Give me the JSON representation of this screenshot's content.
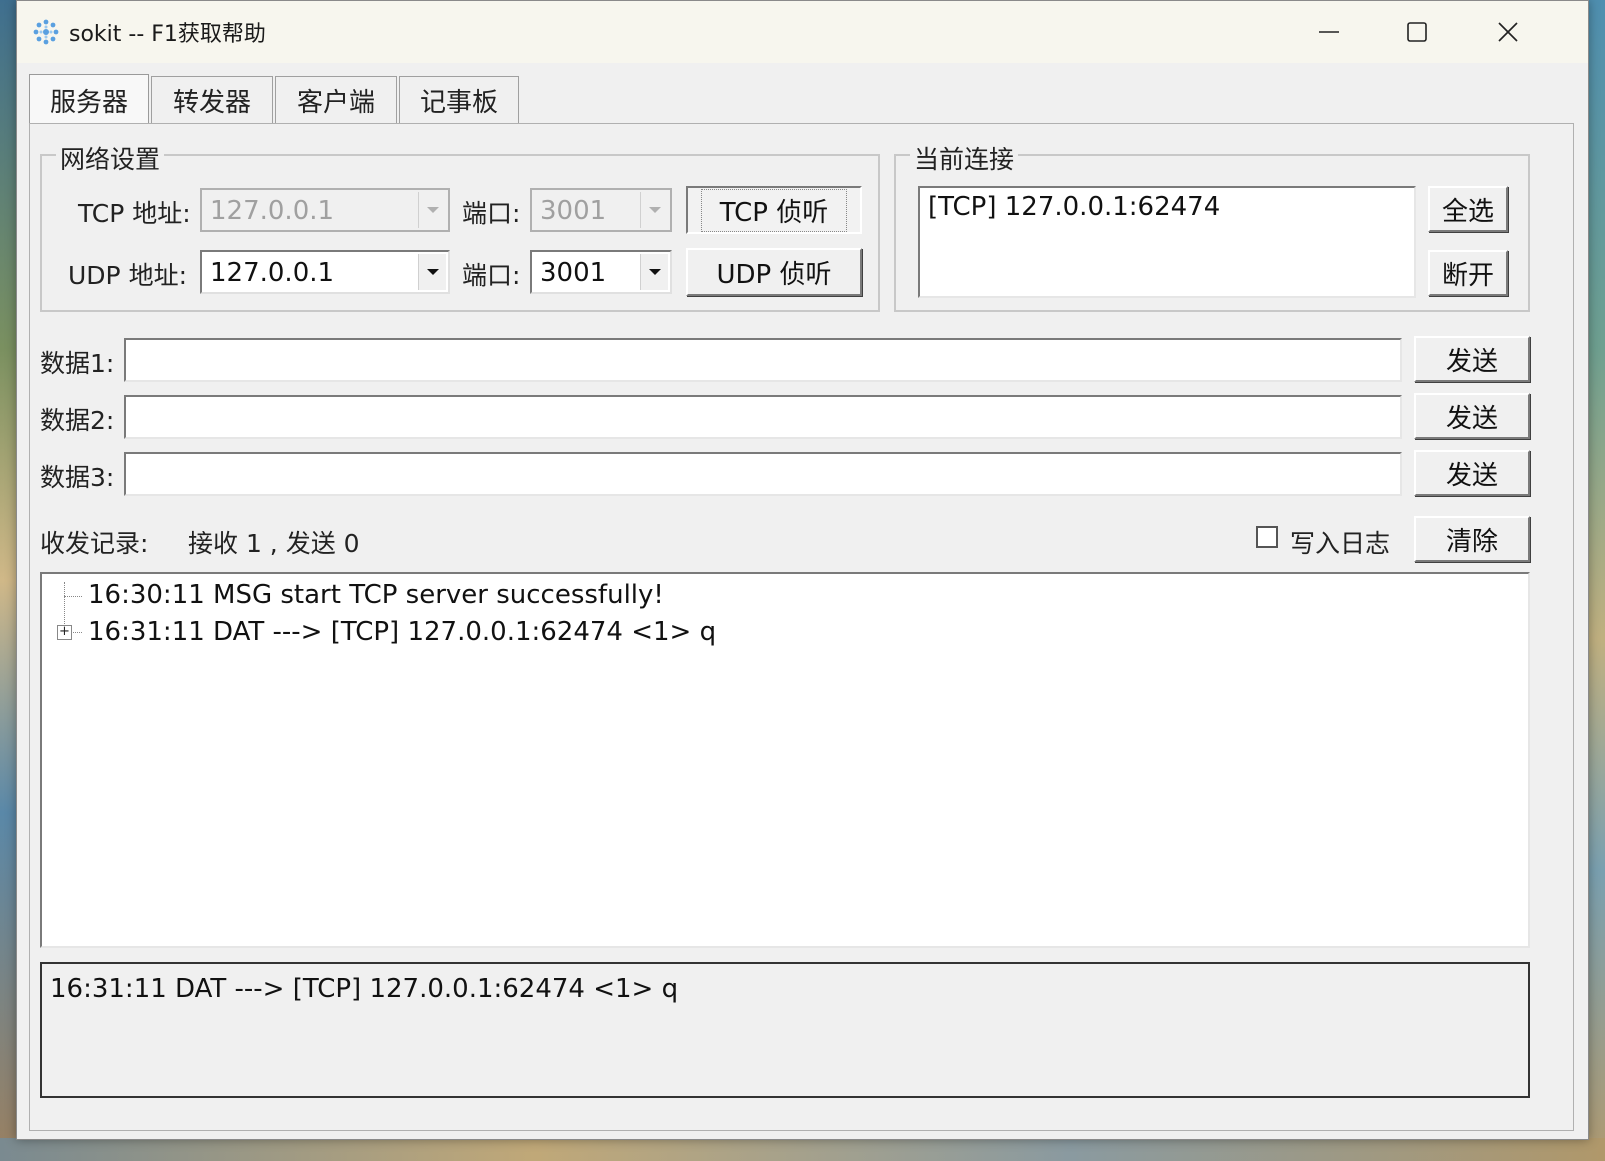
{
  "window": {
    "title": "sokit -- F1获取帮助"
  },
  "tabs": [
    {
      "label": "服务器",
      "active": true
    },
    {
      "label": "转发器",
      "active": false
    },
    {
      "label": "客户端",
      "active": false
    },
    {
      "label": "记事板",
      "active": false
    }
  ],
  "network": {
    "legend": "网络设置",
    "tcp_addr_label": "TCP 地址:",
    "tcp_addr_value": "127.0.0.1",
    "tcp_port_label": "端口:",
    "tcp_port_value": "3001",
    "tcp_listen_button": "TCP 侦听",
    "udp_addr_label": "UDP 地址:",
    "udp_addr_value": "127.0.0.1",
    "udp_port_label": "端口:",
    "udp_port_value": "3001",
    "udp_listen_button": "UDP 侦听"
  },
  "connections": {
    "legend": "当前连接",
    "items": [
      "[TCP] 127.0.0.1:62474"
    ],
    "select_all_button": "全选",
    "disconnect_button": "断开"
  },
  "data_rows": [
    {
      "label": "数据1:",
      "value": "",
      "send_button": "发送"
    },
    {
      "label": "数据2:",
      "value": "",
      "send_button": "发送"
    },
    {
      "label": "数据3:",
      "value": "",
      "send_button": "发送"
    }
  ],
  "log": {
    "label": "收发记录:",
    "stats": "接收 1 , 发送 0",
    "write_log_label": "写入日志",
    "write_log_checked": false,
    "clear_button": "清除",
    "entries": [
      {
        "text": "16:30:11 MSG start TCP server successfully!",
        "expandable": false
      },
      {
        "text": "16:31:11 DAT ---> [TCP] 127.0.0.1:62474 <1> q",
        "expandable": true
      }
    ],
    "detail": "16:31:11 DAT ---> [TCP] 127.0.0.1:62474 <1> q"
  },
  "colors": {
    "window_bg": "#f0f0f0",
    "titlebar_bg": "#f7f6ee",
    "app_icon": "#5aa0e0"
  },
  "icons": {
    "app": "snowflake-icon",
    "minimize": "minimize-icon",
    "maximize": "maximize-icon",
    "close": "close-icon",
    "dropdown": "chevron-down-icon",
    "expand": "plus-box-icon"
  }
}
